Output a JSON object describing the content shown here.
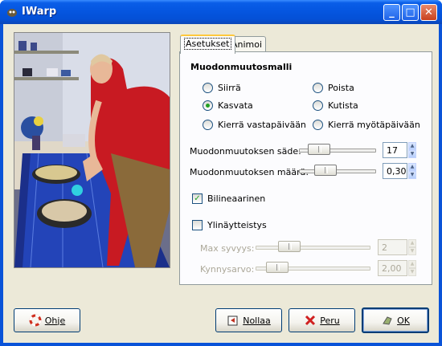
{
  "window": {
    "title": "IWarp"
  },
  "titlebar_buttons": {
    "minimize": "_",
    "maximize": "□",
    "close": "✕"
  },
  "tabs": [
    {
      "label": "Asetukset",
      "active": true
    },
    {
      "label": "Animoi",
      "active": false
    }
  ],
  "settings": {
    "section_title": "Muodonmuutosmalli",
    "modes": [
      {
        "label": "Siirrä",
        "selected": false
      },
      {
        "label": "Poista",
        "selected": false
      },
      {
        "label": "Kasvata",
        "selected": true
      },
      {
        "label": "Kutista",
        "selected": false
      },
      {
        "label": "Kierrä vastapäivään",
        "selected": false
      },
      {
        "label": "Kierrä myötäpäivään",
        "selected": false
      }
    ],
    "radius": {
      "label": "Muodonmuutoksen säde:",
      "value": "17"
    },
    "amount": {
      "label": "Muodonmuutoksen määrä:",
      "value": "0,30"
    },
    "bilinear": {
      "label": "Bilineaarinen",
      "checked": true
    },
    "supersample": {
      "label": "Ylinäytteistys",
      "checked": false
    },
    "max_depth": {
      "label": "Max syvyys:",
      "value": "2"
    },
    "threshold": {
      "label": "Kynnysarvo:",
      "value": "2,00"
    }
  },
  "buttons": {
    "help": "Ohje",
    "reset": "Nollaa",
    "cancel": "Peru",
    "ok": "OK"
  },
  "icons": {
    "help": "lifebuoy-icon",
    "reset": "reset-icon",
    "cancel": "red-x-icon",
    "ok": "ok-hand-icon"
  },
  "colors": {
    "titlebar": "#0556e0",
    "dialog_bg": "#ece9d8",
    "radio_dot": "#22a022"
  }
}
